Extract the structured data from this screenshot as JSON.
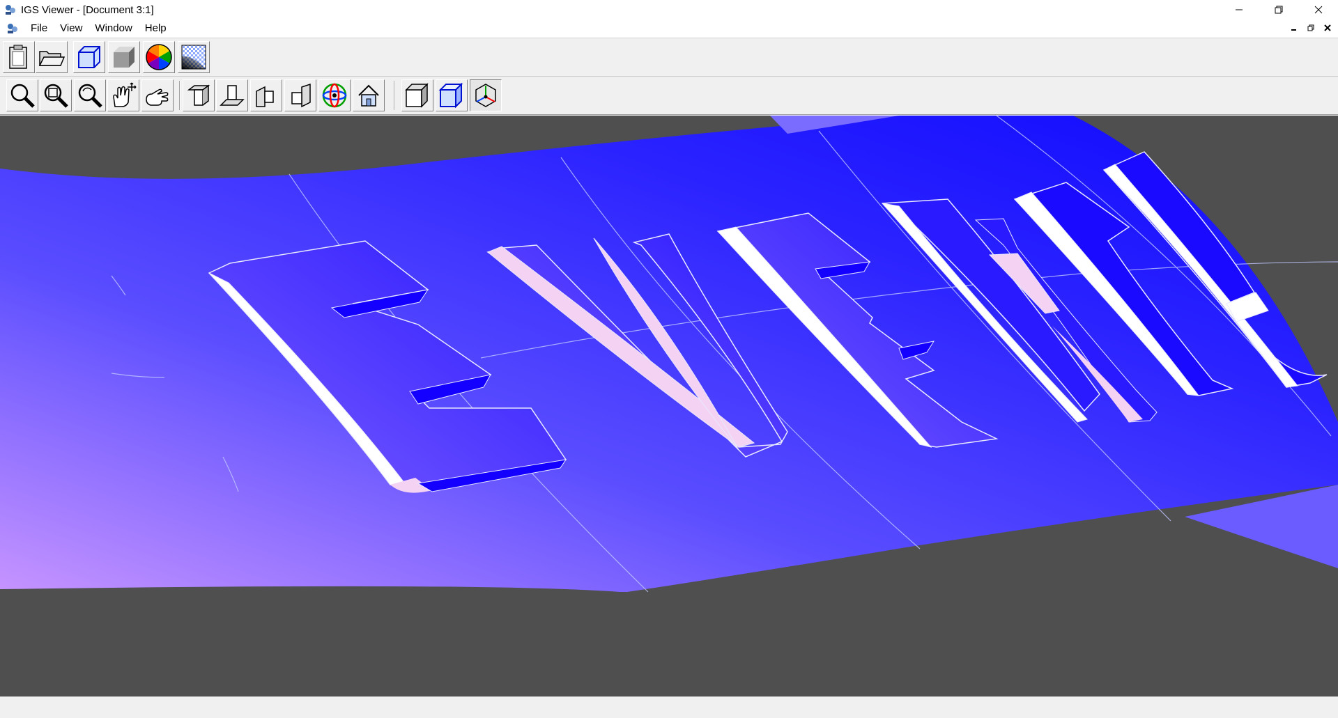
{
  "window": {
    "title": "IGS Viewer - [Document 3:1]"
  },
  "menu": [
    {
      "label": "File"
    },
    {
      "label": "View"
    },
    {
      "label": "Window"
    },
    {
      "label": "Help"
    }
  ],
  "toolbar_top": [
    {
      "icon": "clipboard-icon"
    },
    {
      "icon": "open-folder-icon"
    },
    {
      "icon": "wireframe-box-icon"
    },
    {
      "icon": "shaded-box-icon"
    },
    {
      "icon": "color-wheel-icon"
    },
    {
      "icon": "texture-icon"
    }
  ],
  "toolbar_view": [
    {
      "icon": "zoom-icon"
    },
    {
      "icon": "zoom-window-icon"
    },
    {
      "icon": "zoom-dynamic-icon"
    },
    {
      "icon": "pan-icon"
    },
    {
      "icon": "rotate-hand-icon"
    },
    {
      "icon": "view-top-icon"
    },
    {
      "icon": "view-front-icon"
    },
    {
      "icon": "view-side-icon"
    },
    {
      "icon": "view-right-icon"
    },
    {
      "icon": "orbit-icon"
    },
    {
      "icon": "home-icon"
    },
    {
      "icon": "solid-mode-icon"
    },
    {
      "icon": "wire-mode-icon"
    },
    {
      "icon": "axes-mode-icon"
    }
  ],
  "model": {
    "surface_color": "#2a22ff",
    "surface_highlight": "#c694ff",
    "letter_highlight": "#ffffff",
    "letter_tint": "#f4d2f4",
    "background": "#4f4f4f"
  }
}
